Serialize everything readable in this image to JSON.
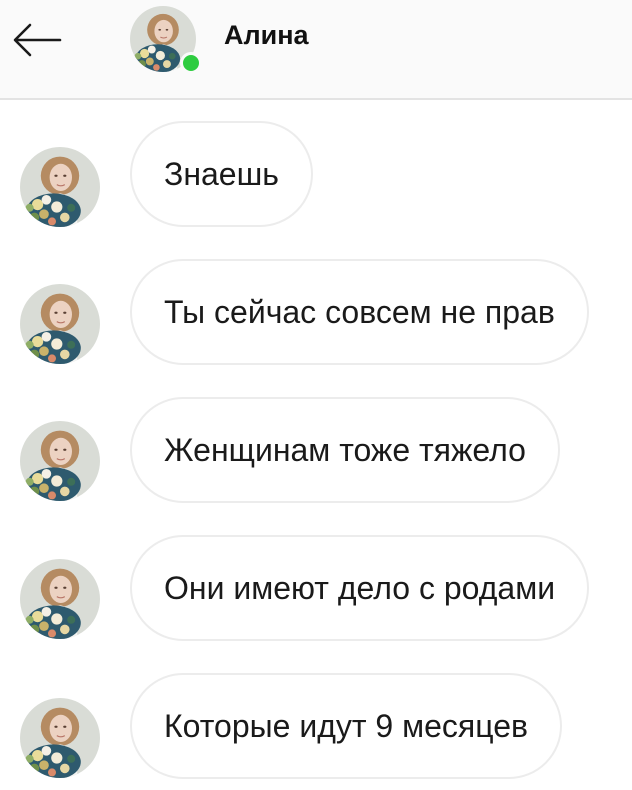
{
  "header": {
    "contact_name": "Алина",
    "online": true
  },
  "messages": [
    {
      "text": "Знаешь"
    },
    {
      "text": "Ты сейчас совсем не прав"
    },
    {
      "text": "Женщинам тоже тяжело"
    },
    {
      "text": "Они имеют дело с родами"
    },
    {
      "text": "Которые идут 9 месяцев"
    }
  ],
  "colors": {
    "online_indicator": "#2ecc40",
    "bubble_border": "#ececec",
    "header_bg": "#fafafa"
  },
  "icons": {
    "back": "arrow-left-icon"
  }
}
